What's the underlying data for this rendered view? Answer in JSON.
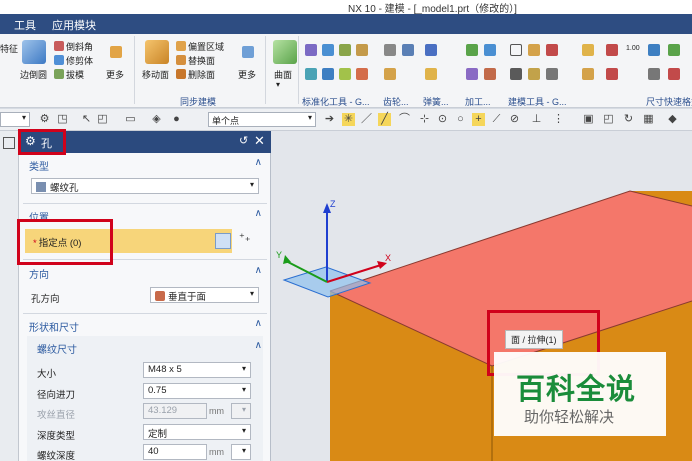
{
  "window": {
    "title": "NX 10 - 建模 - [_model1.prt（修改的）]"
  },
  "menubar": {
    "items": [
      "工具",
      "应用模块"
    ]
  },
  "ribbon": {
    "buttons": {
      "feature_partial": "特征",
      "edge_blend": "边倒圆",
      "chamfer": "倒斜角",
      "trim_body": "修剪体",
      "draft": "拔模",
      "more1": "更多",
      "move_face": "移动面",
      "offset_region": "偏置区域",
      "replace_face": "替换面",
      "delete_face": "删除面",
      "more2": "更多",
      "surface": "曲面",
      "more3": "更多",
      "dim_100": "1.00"
    },
    "groups": {
      "sync_modeling": "同步建模",
      "std_tools": "标准化工具 - G...",
      "gears": "齿轮...",
      "springs": "弹簧...",
      "machining": "加工...",
      "modeling_tools": "建模工具 - G...",
      "dim_quick": "尺寸快速格式"
    }
  },
  "toolbar2": {
    "snap_select": "单个点"
  },
  "panel": {
    "title": "孔",
    "sections": {
      "type": {
        "title": "类型",
        "value": "螺纹孔"
      },
      "position": {
        "title": "位置",
        "specify_point": "指定点 (0)"
      },
      "direction": {
        "title": "方向",
        "label": "孔方向",
        "value": "垂直于面"
      },
      "shape": {
        "title": "形状和尺寸",
        "sub_title": "螺纹尺寸",
        "fields": [
          {
            "label": "大小",
            "value": "M48 x 5",
            "unit": "",
            "disabled": false
          },
          {
            "label": "径向进刀",
            "value": "0.75",
            "unit": "",
            "disabled": false
          },
          {
            "label": "攻丝直径",
            "value": "43.129",
            "unit": "mm",
            "disabled": true
          },
          {
            "label": "深度类型",
            "value": "定制",
            "unit": "",
            "disabled": false
          },
          {
            "label": "螺纹深度",
            "value": "40",
            "unit": "mm",
            "disabled": false
          }
        ]
      }
    }
  },
  "viewport": {
    "axes": {
      "x": "X",
      "y": "Y",
      "z": "Z"
    },
    "tooltip": "面 / 拉伸(1)",
    "colors": {
      "top_face": "#f4776a",
      "side_face": "#d98a15",
      "background": "#e3e6eb"
    }
  },
  "watermark": {
    "big": "百科全说",
    "small": "助你轻松解决"
  }
}
